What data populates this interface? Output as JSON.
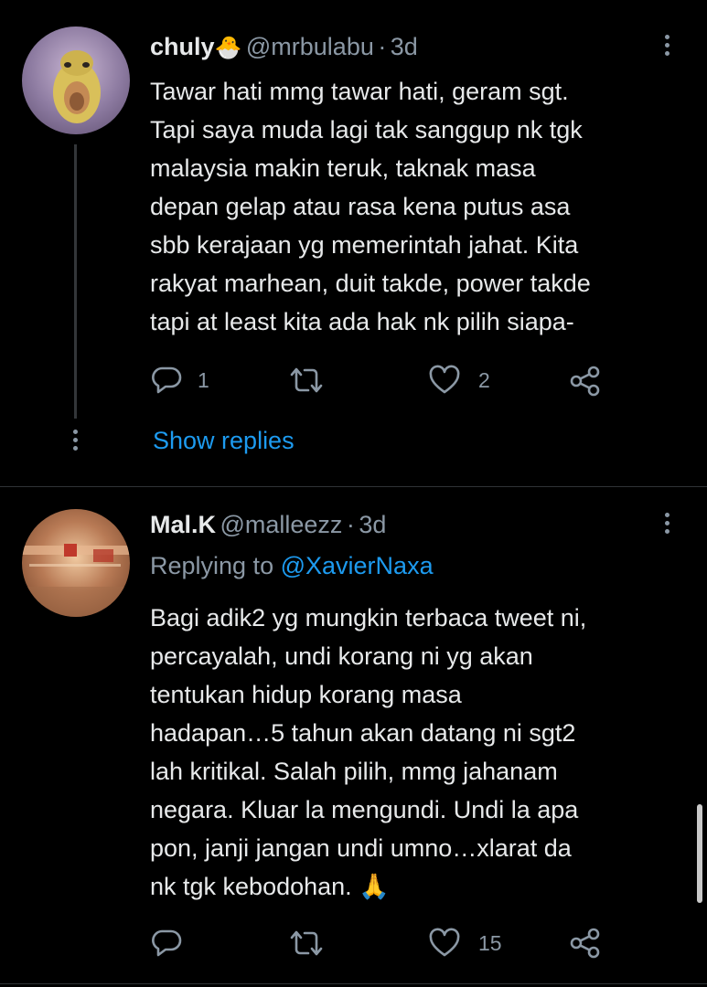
{
  "tweets": [
    {
      "display_name": "chuly",
      "name_emoji": "🐣",
      "handle": "@mrbulabu",
      "dot": "·",
      "age": "3d",
      "lines": [
        "Tawar hati mmg tawar hati, geram sgt.",
        "Tapi saya muda lagi tak sanggup nk tgk",
        "malaysia makin teruk, taknak masa",
        "depan gelap atau rasa kena putus asa",
        "sbb kerajaan yg memerintah jahat. Kita",
        "rakyat marhean, duit takde, power takde",
        "tapi at least kita ada hak nk pilih siapa-"
      ],
      "reply_count": "1",
      "like_count": "2",
      "show_replies": "Show replies"
    },
    {
      "display_name": "Mal.K",
      "handle": "@malleezz",
      "dot": "·",
      "age": "3d",
      "replying_prefix": "Replying to",
      "replying_handle": "@XavierNaxa",
      "lines": [
        "Bagi adik2 yg mungkin terbaca tweet ni,",
        "percayalah, undi korang ni yg akan",
        "tentukan hidup korang masa",
        "hadapan…5 tahun akan datang ni sgt2",
        "lah kritikal. Salah pilih, mmg jahanam",
        "negara. Kluar la mengundi. Undi la apa",
        "pon, janji jangan undi umno…xlarat da",
        "nk tgk kebodohan."
      ],
      "end_emoji": "🙏",
      "like_count": "15"
    }
  ],
  "colors": {
    "background": "#000000",
    "text": "#e7e9ea",
    "muted": "#8b98a5",
    "link": "#1d9bf0",
    "divider": "#2f3336"
  },
  "icons": [
    "reply-icon",
    "retweet-icon",
    "like-icon",
    "share-icon",
    "more-icon"
  ]
}
